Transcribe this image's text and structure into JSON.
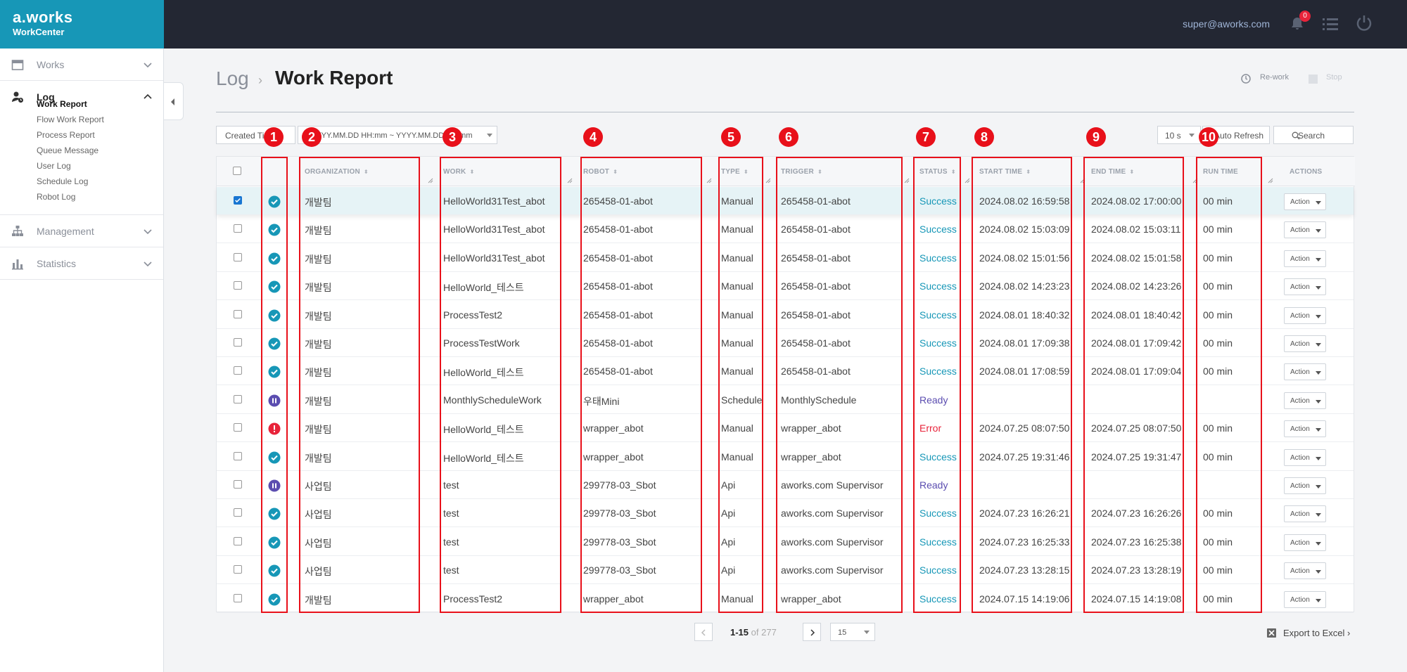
{
  "brand": {
    "logo": "a.works",
    "sub": "WorkCenter"
  },
  "topbar": {
    "user_email": "super@aworks.com",
    "notification_count": "0"
  },
  "sidebar": {
    "items": [
      {
        "label": "Works",
        "icon": "calendar-icon"
      },
      {
        "label": "Log",
        "icon": "user-log-icon"
      },
      {
        "label": "Management",
        "icon": "hierarchy-icon"
      },
      {
        "label": "Statistics",
        "icon": "bar-chart-icon"
      }
    ],
    "sub_items": [
      "Work Report",
      "Flow Work Report",
      "Process Report",
      "Queue Message",
      "User Log",
      "Schedule Log",
      "Robot Log"
    ]
  },
  "breadcrumb": {
    "parent": "Log",
    "current": "Work Report"
  },
  "toolbar": {
    "rework": "Re-work",
    "stop": "Stop"
  },
  "filters": {
    "date_field": "Created Time",
    "date_range_placeholder": "YYYY.MM.DD HH:mm ~ YYYY.MM.DD HH:mm",
    "interval": "10 s",
    "auto_refresh": "Auto Refresh",
    "search": "Search"
  },
  "table": {
    "headers": [
      "ORGANIZATION",
      "WORK",
      "ROBOT",
      "TYPE",
      "TRIGGER",
      "STATUS",
      "START TIME",
      "END TIME",
      "RUN TIME",
      "ACTIONS"
    ],
    "action_label": "Action",
    "rows": [
      {
        "state": "success",
        "org": "개발팀",
        "work": "HelloWorld31Test_abot",
        "robot": "265458-01-abot",
        "type": "Manual",
        "trigger": "265458-01-abot",
        "status": "Success",
        "start": "2024.08.02 16:59:58",
        "end": "2024.08.02 17:00:00",
        "run": "00 min",
        "selected": true
      },
      {
        "state": "success",
        "org": "개발팀",
        "work": "HelloWorld31Test_abot",
        "robot": "265458-01-abot",
        "type": "Manual",
        "trigger": "265458-01-abot",
        "status": "Success",
        "start": "2024.08.02 15:03:09",
        "end": "2024.08.02 15:03:11",
        "run": "00 min"
      },
      {
        "state": "success",
        "org": "개발팀",
        "work": "HelloWorld31Test_abot",
        "robot": "265458-01-abot",
        "type": "Manual",
        "trigger": "265458-01-abot",
        "status": "Success",
        "start": "2024.08.02 15:01:56",
        "end": "2024.08.02 15:01:58",
        "run": "00 min"
      },
      {
        "state": "success",
        "org": "개발팀",
        "work": "HelloWorld_테스트",
        "robot": "265458-01-abot",
        "type": "Manual",
        "trigger": "265458-01-abot",
        "status": "Success",
        "start": "2024.08.02 14:23:23",
        "end": "2024.08.02 14:23:26",
        "run": "00 min"
      },
      {
        "state": "success",
        "org": "개발팀",
        "work": "ProcessTest2",
        "robot": "265458-01-abot",
        "type": "Manual",
        "trigger": "265458-01-abot",
        "status": "Success",
        "start": "2024.08.01 18:40:32",
        "end": "2024.08.01 18:40:42",
        "run": "00 min"
      },
      {
        "state": "success",
        "org": "개발팀",
        "work": "ProcessTestWork",
        "robot": "265458-01-abot",
        "type": "Manual",
        "trigger": "265458-01-abot",
        "status": "Success",
        "start": "2024.08.01 17:09:38",
        "end": "2024.08.01 17:09:42",
        "run": "00 min"
      },
      {
        "state": "success",
        "org": "개발팀",
        "work": "HelloWorld_테스트",
        "robot": "265458-01-abot",
        "type": "Manual",
        "trigger": "265458-01-abot",
        "status": "Success",
        "start": "2024.08.01 17:08:59",
        "end": "2024.08.01 17:09:04",
        "run": "00 min"
      },
      {
        "state": "ready",
        "org": "개발팀",
        "work": "MonthlyScheduleWork",
        "robot": "우태Mini",
        "type": "Schedule",
        "trigger": "MonthlySchedule",
        "status": "Ready",
        "start": "",
        "end": "",
        "run": ""
      },
      {
        "state": "error",
        "org": "개발팀",
        "work": "HelloWorld_테스트",
        "robot": "wrapper_abot",
        "type": "Manual",
        "trigger": "wrapper_abot",
        "status": "Error",
        "start": "2024.07.25 08:07:50",
        "end": "2024.07.25 08:07:50",
        "run": "00 min"
      },
      {
        "state": "success",
        "org": "개발팀",
        "work": "HelloWorld_테스트",
        "robot": "wrapper_abot",
        "type": "Manual",
        "trigger": "wrapper_abot",
        "status": "Success",
        "start": "2024.07.25 19:31:46",
        "end": "2024.07.25 19:31:47",
        "run": "00 min"
      },
      {
        "state": "ready",
        "org": "사업팀",
        "work": "test",
        "robot": "299778-03_Sbot",
        "type": "Api",
        "trigger": "aworks.com Supervisor",
        "status": "Ready",
        "start": "",
        "end": "",
        "run": ""
      },
      {
        "state": "success",
        "org": "사업팀",
        "work": "test",
        "robot": "299778-03_Sbot",
        "type": "Api",
        "trigger": "aworks.com Supervisor",
        "status": "Success",
        "start": "2024.07.23 16:26:21",
        "end": "2024.07.23 16:26:26",
        "run": "00 min"
      },
      {
        "state": "success",
        "org": "사업팀",
        "work": "test",
        "robot": "299778-03_Sbot",
        "type": "Api",
        "trigger": "aworks.com Supervisor",
        "status": "Success",
        "start": "2024.07.23 16:25:33",
        "end": "2024.07.23 16:25:38",
        "run": "00 min"
      },
      {
        "state": "success",
        "org": "사업팀",
        "work": "test",
        "robot": "299778-03_Sbot",
        "type": "Api",
        "trigger": "aworks.com Supervisor",
        "status": "Success",
        "start": "2024.07.23 13:28:15",
        "end": "2024.07.23 13:28:19",
        "run": "00 min"
      },
      {
        "state": "success",
        "org": "개발팀",
        "work": "ProcessTest2",
        "robot": "wrapper_abot",
        "type": "Manual",
        "trigger": "wrapper_abot",
        "status": "Success",
        "start": "2024.07.15 14:19:06",
        "end": "2024.07.15 14:19:08",
        "run": "00 min"
      }
    ]
  },
  "annotations": [
    "1",
    "2",
    "3",
    "4",
    "5",
    "6",
    "7",
    "8",
    "9",
    "10"
  ],
  "pagination": {
    "range": "1-15",
    "of_label": "of",
    "total": "277",
    "page_size": "15"
  },
  "export": {
    "label": "Export to Excel"
  },
  "colors": {
    "brand": "#1797b7",
    "topbar": "#232733",
    "success": "#1797b7",
    "ready": "#5b4db0",
    "error": "#e8233a",
    "annotation": "#e8101a"
  }
}
